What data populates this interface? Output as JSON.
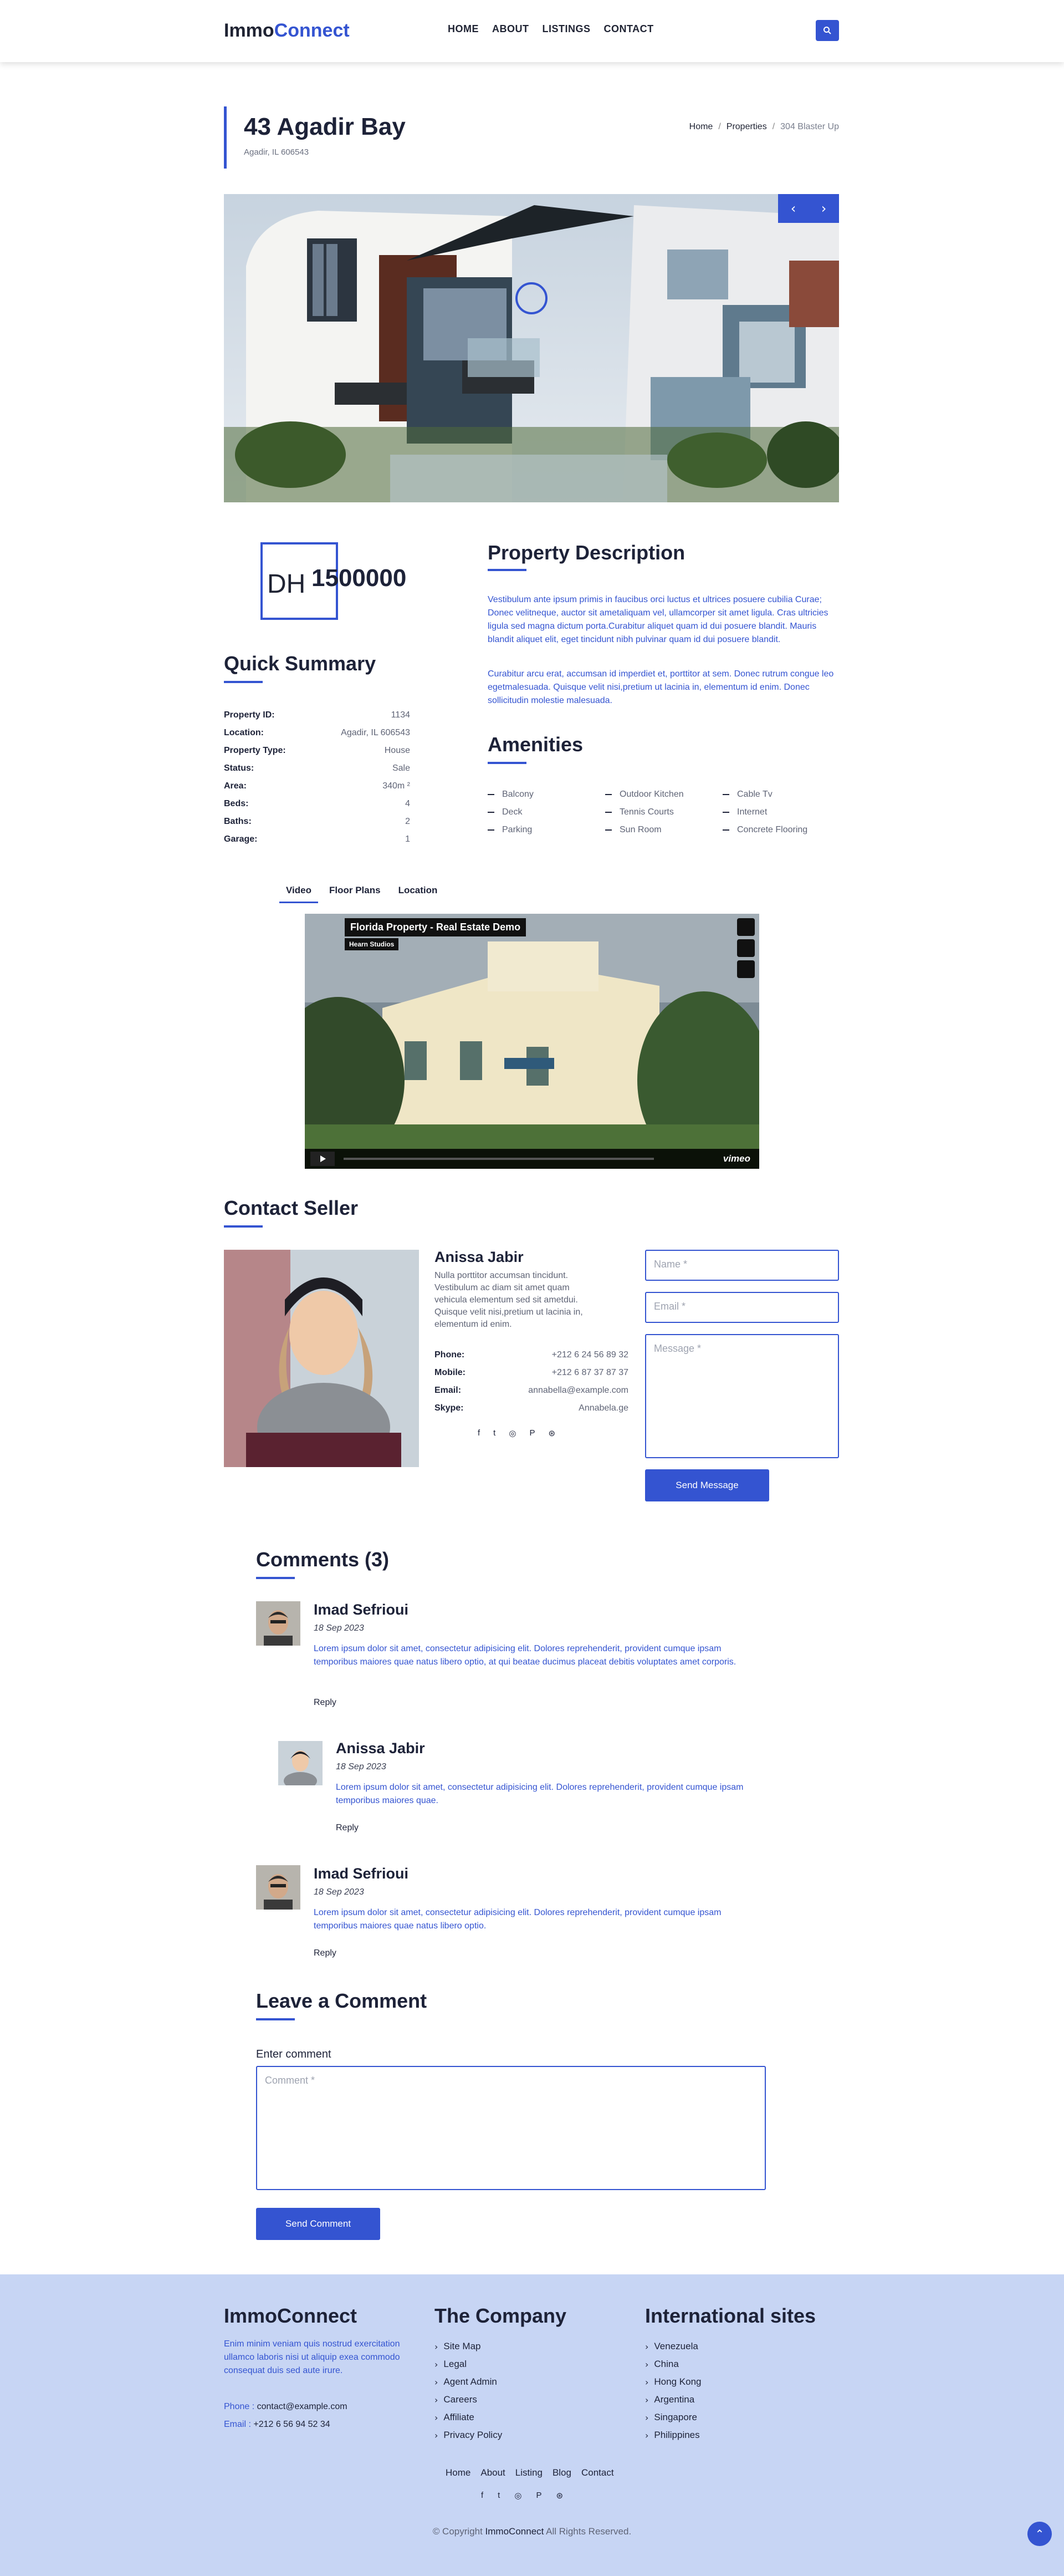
{
  "header": {
    "brand_a": "Immo",
    "brand_b": "Connect",
    "nav": [
      "HOME",
      "ABOUT",
      "LISTINGS",
      "CONTACT"
    ]
  },
  "title": {
    "name": "43 Agadir Bay",
    "address": "Agadir, IL 606543",
    "breadcrumb": [
      "Home",
      "Properties",
      "304 Blaster Up"
    ]
  },
  "price": {
    "currency": "DH",
    "value": "1500000"
  },
  "summary": {
    "heading": "Quick Summary",
    "rows": [
      {
        "k": "Property ID:",
        "v": "1134"
      },
      {
        "k": "Location:",
        "v": "Agadir, IL 606543"
      },
      {
        "k": "Property Type:",
        "v": "House"
      },
      {
        "k": "Status:",
        "v": "Sale"
      },
      {
        "k": "Area:",
        "v": "340m ²"
      },
      {
        "k": "Beds:",
        "v": "4"
      },
      {
        "k": "Baths:",
        "v": "2"
      },
      {
        "k": "Garage:",
        "v": "1"
      }
    ]
  },
  "description": {
    "heading": "Property Description",
    "p1": "Vestibulum ante ipsum primis in faucibus orci luctus et ultrices posuere cubilia Curae; Donec velitneque, auctor sit ametaliquam vel, ullamcorper sit amet ligula. Cras ultricies ligula sed magna dictum porta.Curabitur aliquet quam id dui posuere blandit. Mauris blandit aliquet elit, eget tincidunt nibh pulvinar quam id dui posuere blandit.",
    "p2": "Curabitur arcu erat, accumsan id imperdiet et, porttitor at sem. Donec rutrum congue leo egetmalesuada. Quisque velit nisi,pretium ut lacinia in, elementum id enim. Donec sollicitudin molestie malesuada."
  },
  "amenities": {
    "heading": "Amenities",
    "items": [
      "Balcony",
      "Outdoor Kitchen",
      "Cable Tv",
      "Deck",
      "Tennis Courts",
      "Internet",
      "Parking",
      "Sun Room",
      "Concrete Flooring"
    ]
  },
  "tabs": [
    "Video",
    "Floor Plans",
    "Location"
  ],
  "video": {
    "title": "Florida Property - Real Estate Demo",
    "channel": "Hearn Studios",
    "brand": "vimeo"
  },
  "seller": {
    "heading": "Contact Seller",
    "name": "Anissa Jabir",
    "bio": "Nulla porttitor accumsan tincidunt. Vestibulum ac diam sit amet quam vehicula elementum sed sit ametdui. Quisque velit nisi,pretium ut lacinia in, elementum id enim.",
    "info": [
      {
        "k": "Phone:",
        "v": "+212 6 24 56 89 32"
      },
      {
        "k": "Mobile:",
        "v": "+212 6 87 37 87 37"
      },
      {
        "k": "Email:",
        "v": "annabella@example.com"
      },
      {
        "k": "Skype:",
        "v": "Annabela.ge"
      }
    ],
    "form": {
      "name_ph": "Name *",
      "email_ph": "Email *",
      "message_ph": "Message *",
      "send": "Send Message"
    }
  },
  "comments": {
    "heading": "Comments (3)",
    "list": [
      {
        "name": "Imad Sefrioui",
        "date": "18 Sep 2023",
        "text": "Lorem ipsum dolor sit amet, consectetur adipisicing elit. Dolores reprehenderit, provident cumque ipsam temporibus maiores quae natus libero optio, at qui beatae ducimus placeat debitis voluptates amet corporis.",
        "reply": "Reply"
      },
      {
        "name": "Anissa Jabir",
        "date": "18 Sep 2023",
        "text": "Lorem ipsum dolor sit amet, consectetur adipisicing elit. Dolores reprehenderit, provident cumque ipsam temporibus maiores quae.",
        "reply": "Reply"
      },
      {
        "name": "Imad Sefrioui",
        "date": "18 Sep 2023",
        "text": "Lorem ipsum dolor sit amet, consectetur adipisicing elit. Dolores reprehenderit, provident cumque ipsam temporibus maiores quae natus libero optio.",
        "reply": "Reply"
      }
    ]
  },
  "leave_comment": {
    "heading": "Leave a Comment",
    "label": "Enter comment",
    "placeholder": "Comment *",
    "button": "Send Comment"
  },
  "footer": {
    "brand": "ImmoConnect",
    "about": "Enim minim veniam quis nostrud exercitation ullamco laboris nisi ut aliquip exea commodo consequat duis sed aute irure.",
    "phone_label": "Phone : ",
    "phone": "contact@example.com",
    "email_label": "Email : ",
    "email": "+212 6 56 94 52 34",
    "company_heading": "The Company",
    "company": [
      "Site Map",
      "Legal",
      "Agent Admin",
      "Careers",
      "Affiliate",
      "Privacy Policy"
    ],
    "intl_heading": "International sites",
    "intl": [
      "Venezuela",
      "China",
      "Hong Kong",
      "Argentina",
      "Singapore",
      "Philippines"
    ],
    "bottom_nav": [
      "Home",
      "About",
      "Listing",
      "Blog",
      "Contact"
    ],
    "copy_a": "© Copyright ",
    "copy_brand": "ImmoConnect",
    "copy_b": " All Rights Reserved."
  },
  "colors": {
    "accent": "#3454d1",
    "footer_bg": "#c7d5f4",
    "heading": "#1d2238"
  },
  "icons": [
    "search-icon",
    "chevron-left-icon",
    "chevron-right-icon",
    "facebook-icon",
    "twitter-icon",
    "instagram-icon",
    "pinterest-icon",
    "dribbble-icon",
    "arrow-up-icon"
  ]
}
